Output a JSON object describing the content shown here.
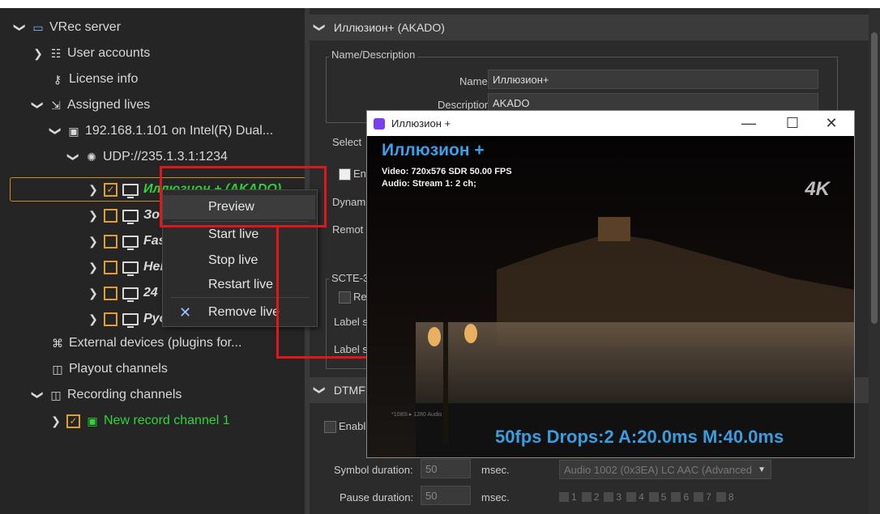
{
  "tree": {
    "root": "VRec server",
    "user_accounts": "User accounts",
    "license_info": "License info",
    "assigned_lives": "Assigned lives",
    "adapter": "192.168.1.101 on Intel(R) Dual...",
    "udp": "UDP://235.1.3.1:1234",
    "channels": [
      "Иллюзион + (AKADO)",
      "Зо",
      "Fas",
      "Hei",
      "24",
      "Рус"
    ],
    "external_devices": "External devices (plugins for...",
    "playout_channels": "Playout channels",
    "recording_channels": "Recording channels",
    "record_channel": "New record channel 1"
  },
  "context_menu": {
    "preview": "Preview",
    "start_live": "Start live",
    "stop_live": "Stop live",
    "restart_live": "Restart live",
    "remove_live": "Remove live"
  },
  "panel": {
    "header": "Иллюзион+ (AKADO)",
    "name_desc_group": "Name/Description",
    "name_label": "Name",
    "name_value": "Иллюзион+",
    "desc_label": "Description",
    "desc_value": "AKADO",
    "select_label": "Select",
    "enable_label": "En",
    "dynam_label": "Dynam",
    "remote_label": "Remot",
    "scte_label": "SCTE-3",
    "read_label": "Rea",
    "label_s1": "Label s",
    "label_s2": "Label s",
    "dtmf_header": "DTMF",
    "enable2_label": "Enabl",
    "symbol_duration_label": "Symbol duration:",
    "symbol_duration_value": "50",
    "pause_duration_label": "Pause duration:",
    "pause_duration_value": "50",
    "msec1": "msec.",
    "msec2": "msec.",
    "audio_select": "Audio 1002 (0x3EA) LC AAC (Advanced",
    "digits": [
      "1",
      "2",
      "3",
      "4",
      "5",
      "6",
      "7",
      "8"
    ]
  },
  "preview_window": {
    "title": "Иллюзион +",
    "minimize": "—",
    "maximize": "☐",
    "close": "✕",
    "channel_title": "Иллюзион +",
    "video_info": "Video: 720x576 SDR 50.00 FPS",
    "audio_info": "Audio: Stream 1: 2 ch;",
    "badge": "4K",
    "stats": "50fps Drops:2 A:20.0ms M:40.0ms",
    "tiny_text": "*1080i ▸ 1280 Audio"
  },
  "colors": {
    "accent_green": "#31d43b",
    "highlight": "#e2141c",
    "checkbox": "#e0a030",
    "overlay_blue": "#3a9de0"
  }
}
